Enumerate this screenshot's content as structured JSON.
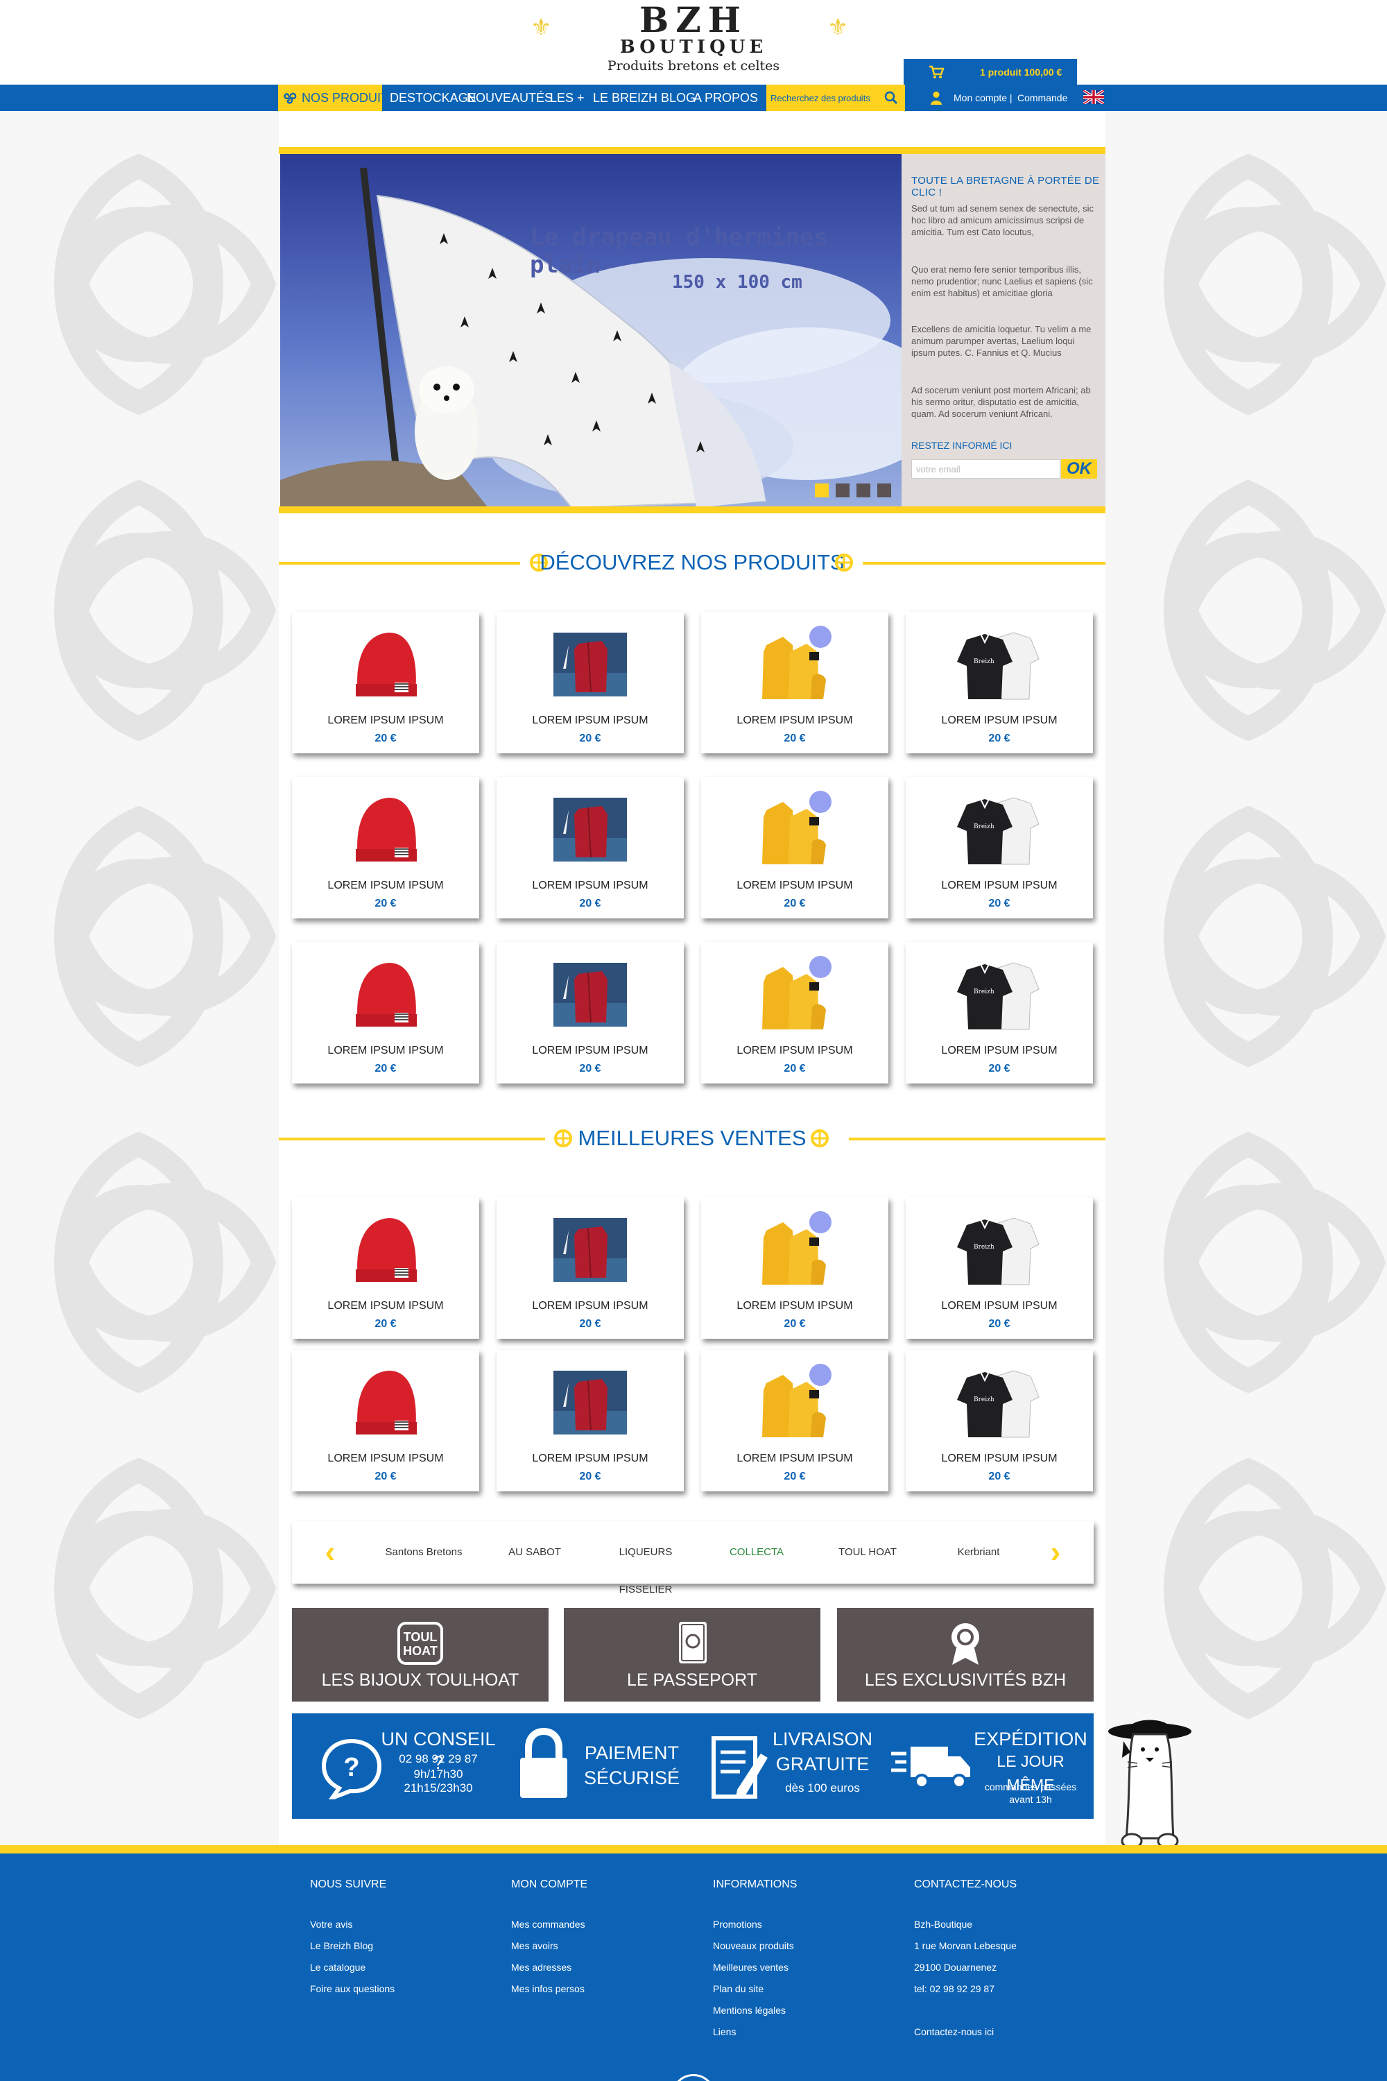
{
  "logo": {
    "line1": "BZH",
    "line2": "BOUTIQUE",
    "line3": "Produits bretons et celtes"
  },
  "cart": {
    "text": "1 produit  100,00 €"
  },
  "nav": {
    "items": [
      {
        "label": "NOS PRODUITS"
      },
      {
        "label": "DESTOCKAGE"
      },
      {
        "label": "NOUVEAUTÉS"
      },
      {
        "label": "LES +"
      },
      {
        "label": "LE BREIZH BLOG"
      },
      {
        "label": "A PROPOS"
      }
    ],
    "search_placeholder": "Recherchez des produits",
    "account": "Mon compte |",
    "order": "Commande"
  },
  "slider": {
    "caption": "Le drapeau d'hermines plain",
    "subcaption": "150 x 100 cm",
    "active_slide": 1,
    "slide_count": 4
  },
  "side_panel": {
    "title": "TOUTE LA BRETAGNE À PORTÉE DE CLIC !",
    "paragraphs": [
      "Sed ut tum ad senem senex de senectute, sic hoc libro ad amicum amicissimus scripsi de amicitia. Tum est Cato locutus,",
      "Quo erat nemo fere senior temporibus illis, nemo prudentior; nunc Laelius et sapiens (sic enim est habitus) et amicitiae gloria",
      "Excellens de amicitia loquetur. Tu velim a me animum parumper avertas, Laelium loqui ipsum putes. C. Fannius et Q. Mucius",
      "Ad socerum veniunt post mortem Africani; ab his sermo oritur, disputatio est de amicitia, quam. Ad socerum veniunt Africani."
    ],
    "newsletter_label": "RESTEZ INFORMÉ ICI",
    "email_placeholder": "votre email",
    "ok_label": "OK"
  },
  "section1": {
    "title": "DÉCOUVREZ NOS PRODUITS"
  },
  "section2": {
    "title": "MEILLEURES VENTES"
  },
  "products": [
    {
      "name": "LOREM IPSUM IPSUM",
      "price": "20 €",
      "kind": "bonnet"
    },
    {
      "name": "LOREM IPSUM IPSUM",
      "price": "20 €",
      "kind": "veste-mer"
    },
    {
      "name": "LOREM IPSUM IPSUM",
      "price": "20 €",
      "kind": "cire-jaune"
    },
    {
      "name": "LOREM IPSUM IPSUM",
      "price": "20 €",
      "kind": "polo-noir"
    },
    {
      "name": "LOREM IPSUM IPSUM",
      "price": "20 €",
      "kind": "bonnet"
    },
    {
      "name": "LOREM IPSUM IPSUM",
      "price": "20 €",
      "kind": "veste-mer"
    },
    {
      "name": "LOREM IPSUM IPSUM",
      "price": "20 €",
      "kind": "cire-jaune"
    },
    {
      "name": "LOREM IPSUM IPSUM",
      "price": "20 €",
      "kind": "polo-noir"
    },
    {
      "name": "LOREM IPSUM IPSUM",
      "price": "20 €",
      "kind": "bonnet"
    },
    {
      "name": "LOREM IPSUM IPSUM",
      "price": "20 €",
      "kind": "veste-mer"
    },
    {
      "name": "LOREM IPSUM IPSUM",
      "price": "20 €",
      "kind": "cire-jaune"
    },
    {
      "name": "LOREM IPSUM IPSUM",
      "price": "20 €",
      "kind": "polo-noir"
    }
  ],
  "bestsellers": [
    {
      "name": "LOREM IPSUM IPSUM",
      "price": "20 €",
      "kind": "bonnet"
    },
    {
      "name": "LOREM IPSUM IPSUM",
      "price": "20 €",
      "kind": "veste-mer"
    },
    {
      "name": "LOREM IPSUM IPSUM",
      "price": "20 €",
      "kind": "cire-jaune"
    },
    {
      "name": "LOREM IPSUM IPSUM",
      "price": "20 €",
      "kind": "polo-noir"
    },
    {
      "name": "LOREM IPSUM IPSUM",
      "price": "20 €",
      "kind": "bonnet"
    },
    {
      "name": "LOREM IPSUM IPSUM",
      "price": "20 €",
      "kind": "veste-mer"
    },
    {
      "name": "LOREM IPSUM IPSUM",
      "price": "20 €",
      "kind": "cire-jaune"
    },
    {
      "name": "LOREM IPSUM IPSUM",
      "price": "20 €",
      "kind": "polo-noir"
    }
  ],
  "brands": [
    {
      "label": "Santons Bretons"
    },
    {
      "label": "AU SABOT"
    },
    {
      "label": "LIQUEURS FISSELIER"
    },
    {
      "label": "COLLECTA"
    },
    {
      "label": "TOUL HOAT"
    },
    {
      "label": "Kerbriant"
    }
  ],
  "tiles": [
    {
      "label": "LES BIJOUX TOULHOAT",
      "icon": "toulhoat-logo-icon"
    },
    {
      "label": "LE PASSEPORT",
      "icon": "passport-icon"
    },
    {
      "label": "LES EXCLUSIVITÉS BZH",
      "icon": "award-icon"
    }
  ],
  "services": {
    "advice": {
      "title": "UN CONSEIL ?",
      "phone": "02 98 92 29 87",
      "hours1": "9h/17h30",
      "hours2": "21h15/23h30"
    },
    "payment": {
      "line1": "PAIEMENT",
      "line2": "SÉCURISÉ"
    },
    "delivery": {
      "line1": "LIVRAISON",
      "line2": "GRATUITE",
      "note": "dès 100 euros"
    },
    "shipping": {
      "line1": "EXPÉDITION",
      "line2": "LE JOUR MÊME",
      "note1": "commandes passées",
      "note2": "avant 13h"
    }
  },
  "footer": {
    "columns": [
      {
        "title": "NOUS SUIVRE",
        "items": [
          "Votre avis",
          "Le Breizh Blog",
          "Le catalogue",
          "Foire aux questions"
        ]
      },
      {
        "title": "MON COMPTE",
        "items": [
          "Mes commandes",
          "Mes avoirs",
          "Mes adresses",
          "Mes infos persos"
        ]
      },
      {
        "title": "INFORMATIONS",
        "items": [
          "Promotions",
          "Nouveaux  produits",
          "Meilleures ventes",
          "Plan du site",
          "Mentions légales",
          "Liens"
        ]
      },
      {
        "title": "CONTACTEZ-NOUS",
        "items": [
          "Bzh-Boutique",
          "1 rue Morvan Lebesque",
          "29100 Douarnenez",
          "tel: 02 98 92 29 87",
          "",
          "Contactez-nous ici"
        ]
      }
    ]
  },
  "colors": {
    "brand_blue": "#0c63b5",
    "brand_yellow": "#ffd21f",
    "tile_grey": "#5a5253"
  }
}
